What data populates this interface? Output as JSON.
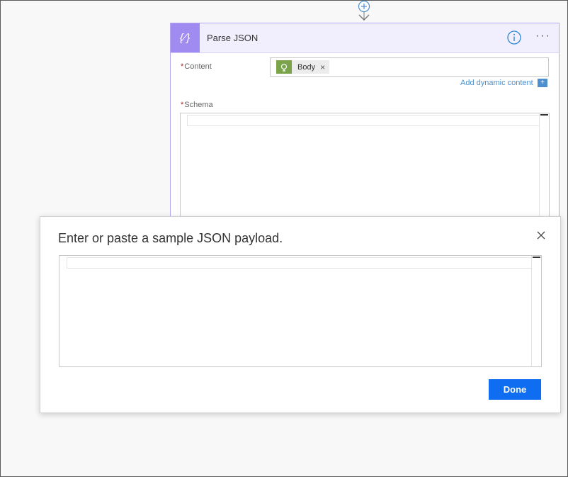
{
  "card": {
    "title": "Parse JSON",
    "icon": "braces-icon",
    "icon_glyph": "{⁄}",
    "more_glyph": "···",
    "header_color": "#f1effe",
    "accent_color": "#a08cf0"
  },
  "fields": {
    "content": {
      "required_mark": "*",
      "label": "Content",
      "token_label": "Body",
      "token_remove": "×"
    },
    "dynamic_link": "Add dynamic content",
    "dynamic_plus": "+",
    "schema": {
      "required_mark": "*",
      "label": "Schema"
    }
  },
  "dialog": {
    "title": "Enter or paste a sample JSON payload.",
    "done_label": "Done",
    "primary_color": "#0f6df2"
  }
}
